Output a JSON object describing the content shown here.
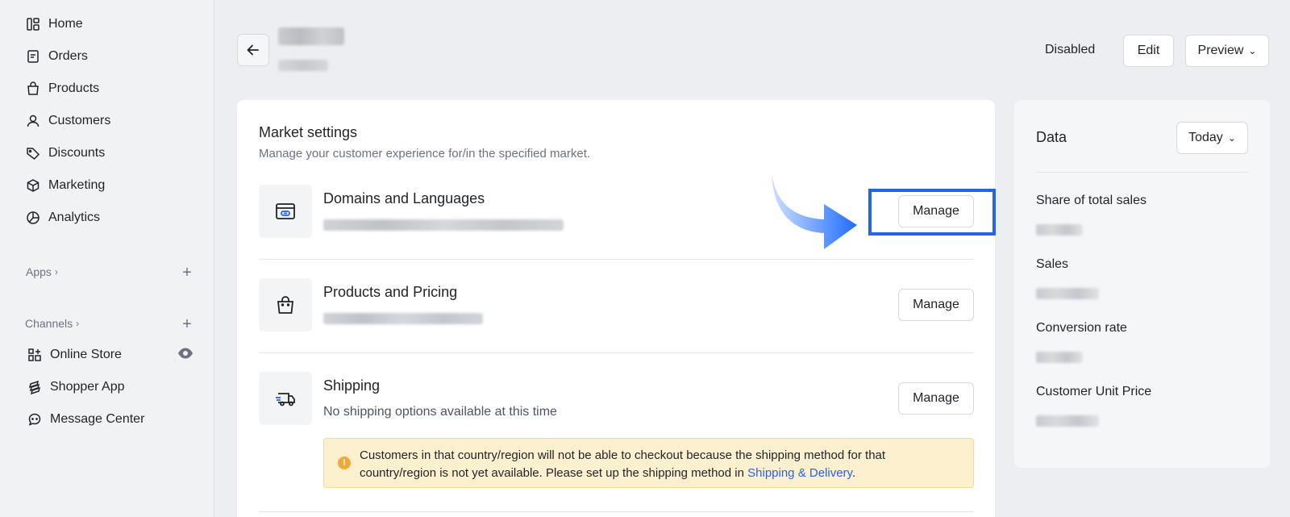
{
  "sidebar": {
    "items": [
      {
        "label": "Home",
        "icon": "home-icon"
      },
      {
        "label": "Orders",
        "icon": "orders-icon"
      },
      {
        "label": "Products",
        "icon": "products-icon"
      },
      {
        "label": "Customers",
        "icon": "customers-icon"
      },
      {
        "label": "Discounts",
        "icon": "discounts-icon"
      },
      {
        "label": "Marketing",
        "icon": "marketing-icon"
      },
      {
        "label": "Analytics",
        "icon": "analytics-icon"
      }
    ],
    "apps_label": "Apps",
    "channels_label": "Channels",
    "channels": [
      {
        "label": "Online Store",
        "icon": "online-store-icon"
      },
      {
        "label": "Shopper App",
        "icon": "shopper-app-icon"
      },
      {
        "label": "Message Center",
        "icon": "message-center-icon"
      }
    ]
  },
  "header": {
    "status": "Disabled",
    "edit_label": "Edit",
    "preview_label": "Preview"
  },
  "market_settings": {
    "title": "Market settings",
    "description": "Manage your customer experience for/in the specified market.",
    "rows": [
      {
        "title": "Domains and Languages",
        "button": "Manage",
        "icon": "domain-icon"
      },
      {
        "title": "Products and Pricing",
        "button": "Manage",
        "icon": "shopping-bag-icon"
      },
      {
        "title": "Shipping",
        "subtitle": "No shipping options available at this time",
        "button": "Manage",
        "icon": "truck-icon"
      }
    ],
    "warning": {
      "text": "Customers in that country/region will not be able to checkout because the shipping method for that country/region is not yet available. Please set up the shipping method in ",
      "link": "Shipping & Delivery",
      "end": "."
    }
  },
  "data_panel": {
    "title": "Data",
    "range_label": "Today",
    "metrics": [
      {
        "label": "Share of total sales"
      },
      {
        "label": "Sales"
      },
      {
        "label": "Conversion rate"
      },
      {
        "label": "Customer Unit Price"
      }
    ]
  },
  "colors": {
    "accent": "#2563eb",
    "warning_bg": "#fdf0cf",
    "warning_icon": "#f2a93b"
  }
}
